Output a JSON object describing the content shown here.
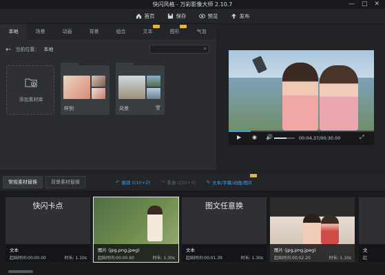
{
  "window": {
    "title": "快闪风格 - 万彩影像大师 2.10.7",
    "minimize": "—",
    "maximize": "□",
    "close": "✕"
  },
  "toolbar": {
    "home": "首页",
    "save": "保存",
    "preview": "预览",
    "publish": "发布"
  },
  "tabs": [
    {
      "label": "本地",
      "active": true
    },
    {
      "label": "场景"
    },
    {
      "label": "动画"
    },
    {
      "label": "背景"
    },
    {
      "label": "组合"
    },
    {
      "label": "文本",
      "badge": true
    },
    {
      "label": "图形",
      "badge": true
    },
    {
      "label": "气泡"
    }
  ],
  "path": {
    "back": "←",
    "label": "当前位置：",
    "current": "本地"
  },
  "search": {
    "placeholder": ""
  },
  "library": {
    "add_label": "添加素材库",
    "folders": [
      {
        "name": "样例"
      },
      {
        "name": "风景"
      }
    ]
  },
  "player": {
    "time": "00:04.37/00:30.00",
    "progress": 0.15,
    "volume": 0.6
  },
  "bottom": {
    "tabs": [
      "常规素材替换",
      "背景素材替换"
    ],
    "actions": {
      "undo": "撤销 (Ctrl+Z)",
      "redo": "重做 (Ctrl+Y)",
      "edit": "文本/字幕/动画/图片"
    }
  },
  "cards": [
    {
      "title": "快闪卡点",
      "kind": "文本",
      "start": "起始时间:00:00.00",
      "duration": "时长: 1.10s"
    },
    {
      "title": "",
      "kind": "图片 (jpg,png,jpeg)",
      "start": "起始时间:00:00.60",
      "duration": "时长: 1.30s"
    },
    {
      "title": "图文任意换",
      "kind": "文本",
      "start": "起始时间:00:01.39",
      "duration": "时长: 1.30s"
    },
    {
      "title": "",
      "kind": "图片 (jpg,png,jpeg)",
      "start": "起始时间:00:02.20",
      "duration": "时长: 1.10s"
    },
    {
      "title": "",
      "kind": "文",
      "start": "起",
      "duration": ""
    }
  ],
  "colors": {
    "accent": "#3f9ee8",
    "badge": "#e3b63a",
    "edit": "#3f9ee8"
  }
}
